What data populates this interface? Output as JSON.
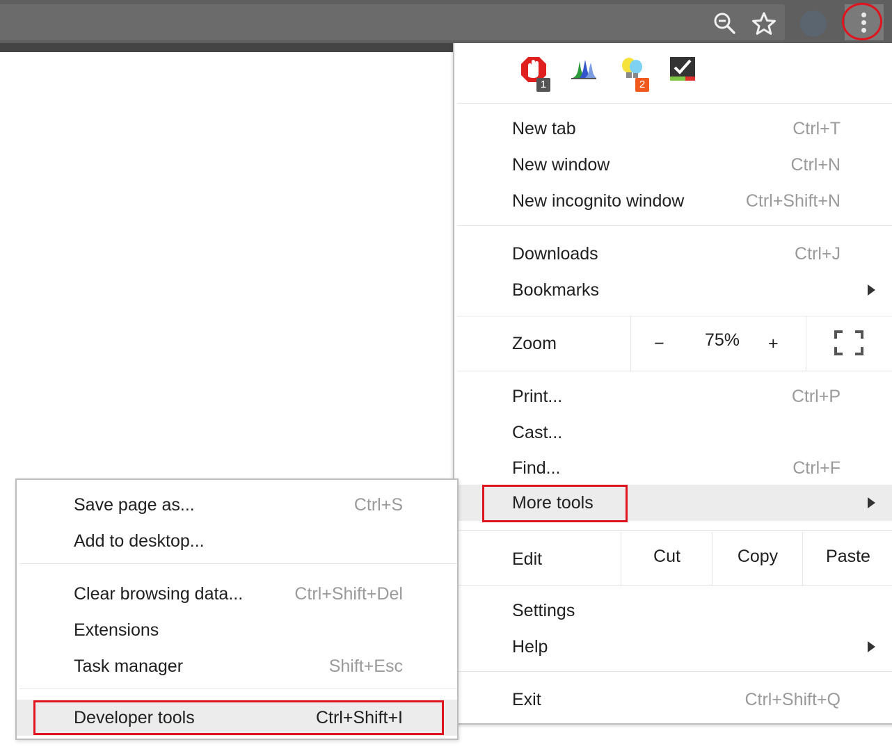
{
  "toolbar": {
    "zoom_icon": "zoom-out-magnifier-icon",
    "bookmark_icon": "star-icon",
    "profile_icon": "profile-avatar-icon",
    "menu_icon": "three-dot-vertical-icon"
  },
  "extensions": [
    {
      "name": "adblock-icon",
      "badge": "1",
      "badge_color": "#555555"
    },
    {
      "name": "chart-bars-icon",
      "badge": "",
      "badge_color": ""
    },
    {
      "name": "lightbulb-icon",
      "badge": "2",
      "badge_color": "#f25a1d"
    },
    {
      "name": "checkmark-icon",
      "badge": "",
      "badge_color": ""
    }
  ],
  "main_menu": {
    "new_tab": {
      "label": "New tab",
      "shortcut": "Ctrl+T"
    },
    "new_window": {
      "label": "New window",
      "shortcut": "Ctrl+N"
    },
    "new_incognito": {
      "label": "New incognito window",
      "shortcut": "Ctrl+Shift+N"
    },
    "downloads": {
      "label": "Downloads",
      "shortcut": "Ctrl+J"
    },
    "bookmarks": {
      "label": "Bookmarks"
    },
    "zoom": {
      "label": "Zoom",
      "minus": "−",
      "value": "75%",
      "plus": "+"
    },
    "print": {
      "label": "Print...",
      "shortcut": "Ctrl+P"
    },
    "cast": {
      "label": "Cast..."
    },
    "find": {
      "label": "Find...",
      "shortcut": "Ctrl+F"
    },
    "more_tools": {
      "label": "More tools"
    },
    "edit": {
      "label": "Edit",
      "cut": "Cut",
      "copy": "Copy",
      "paste": "Paste"
    },
    "settings": {
      "label": "Settings"
    },
    "help": {
      "label": "Help"
    },
    "exit": {
      "label": "Exit",
      "shortcut": "Ctrl+Shift+Q"
    }
  },
  "sub_menu": {
    "save_page": {
      "label": "Save page as...",
      "shortcut": "Ctrl+S"
    },
    "add_desktop": {
      "label": "Add to desktop..."
    },
    "clear_data": {
      "label": "Clear browsing data...",
      "shortcut": "Ctrl+Shift+Del"
    },
    "extensions": {
      "label": "Extensions"
    },
    "task_manager": {
      "label": "Task manager",
      "shortcut": "Shift+Esc"
    },
    "developer_tools": {
      "label": "Developer tools",
      "shortcut": "Ctrl+Shift+I"
    }
  },
  "colors": {
    "highlight": "#e0141e",
    "hover": "#ececec",
    "toolbar": "#5f5f5f"
  }
}
